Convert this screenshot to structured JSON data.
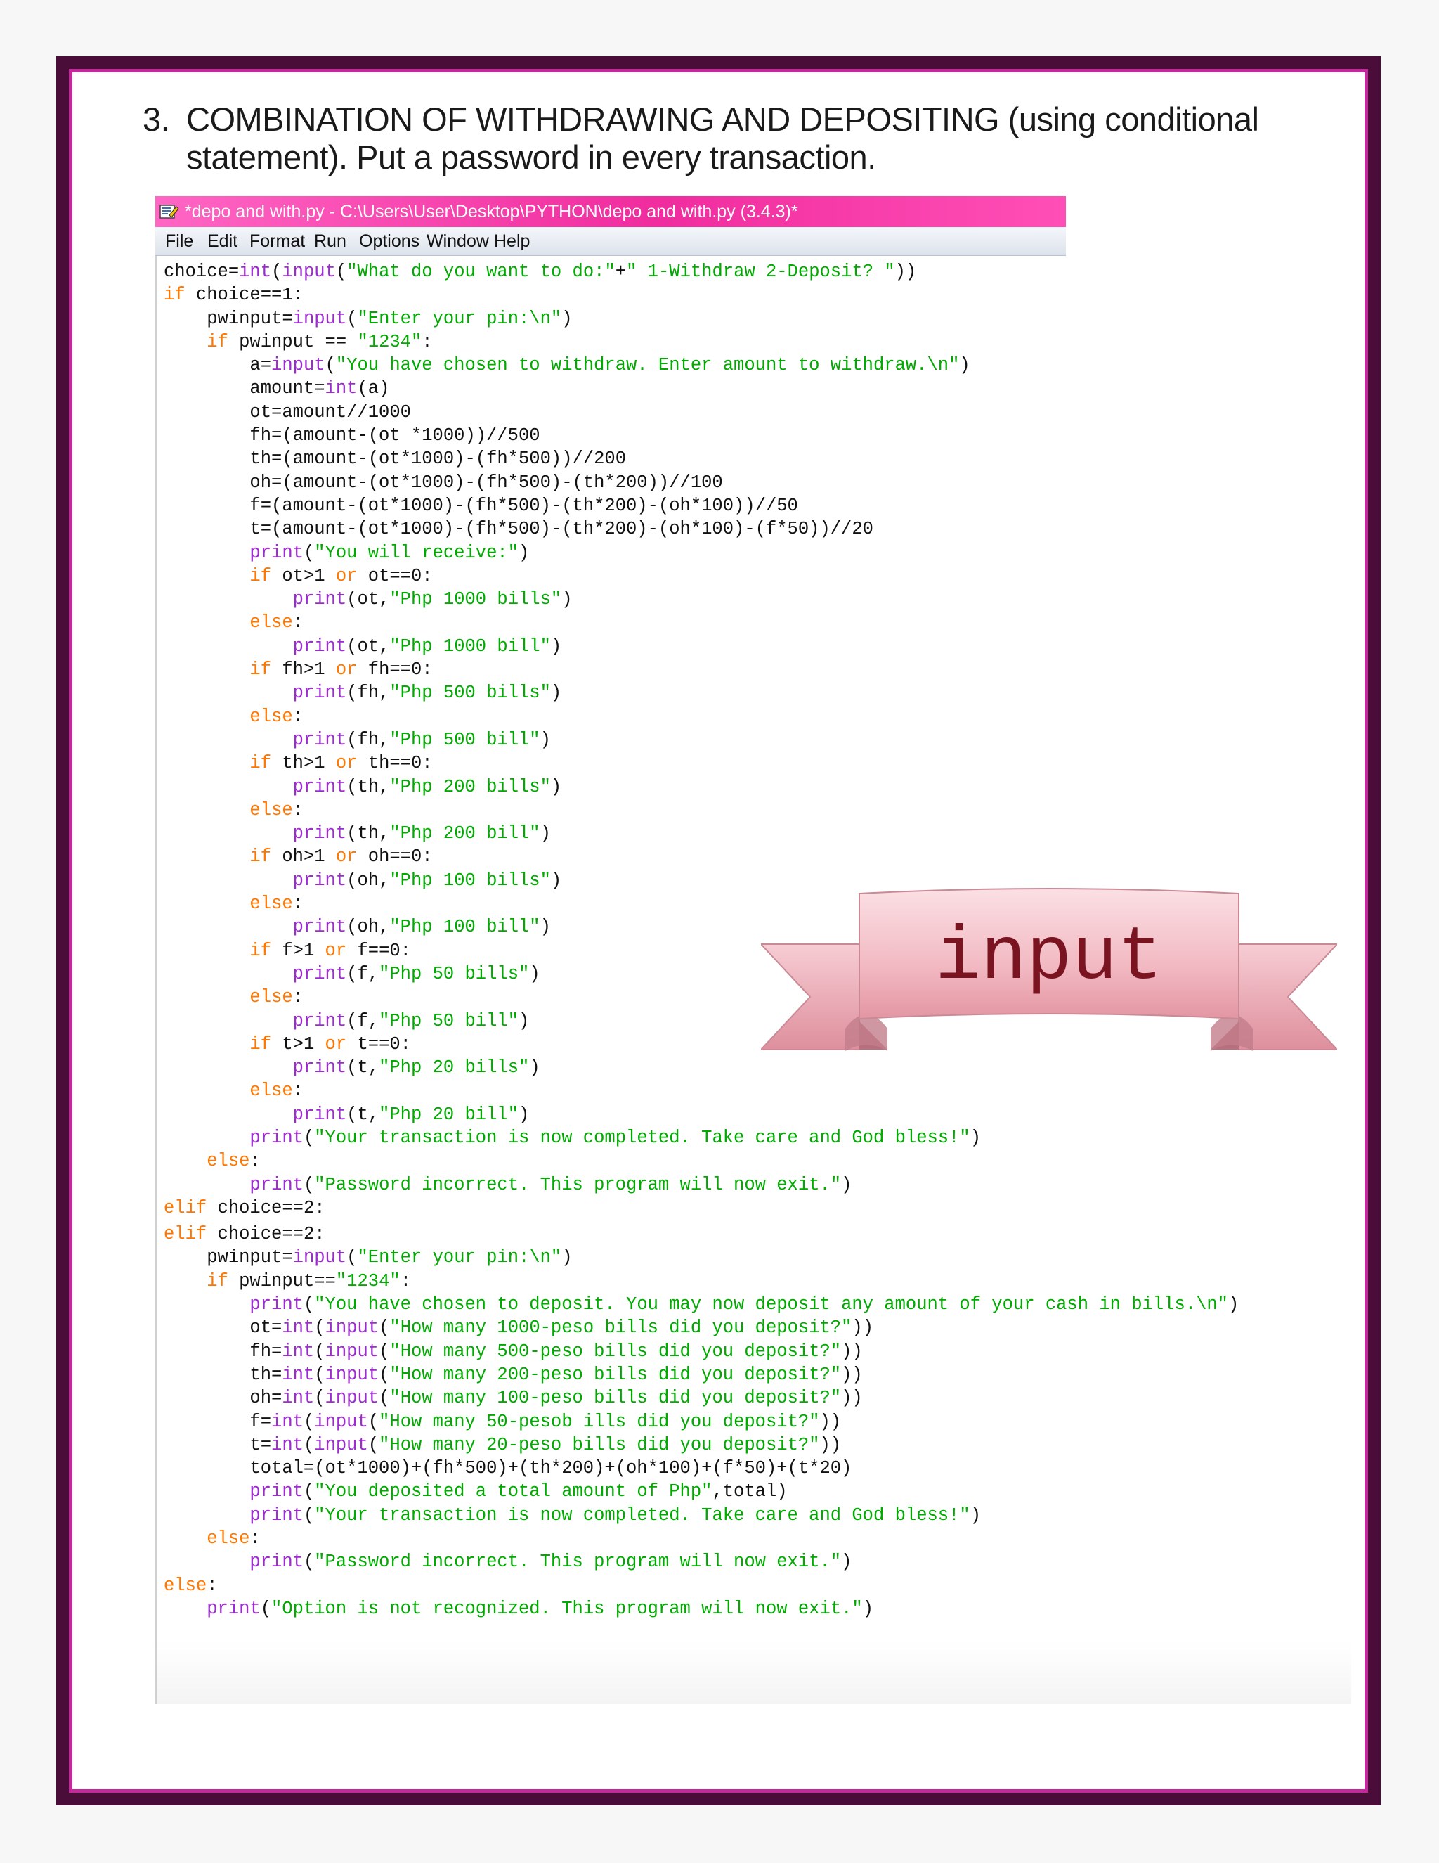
{
  "heading": {
    "number": "3.",
    "line1": "COMBINATION OF WITHDRAWING AND DEPOSITING (using conditional",
    "line2": "statement). Put a password in every transaction."
  },
  "window": {
    "title": "*depo and with.py - C:\\Users\\User\\Desktop\\PYTHON\\depo and with.py (3.4.3)*",
    "icon": "python-idle-icon",
    "menu": [
      "File",
      "Edit",
      "Format",
      "Run",
      "Options",
      "Window",
      "Help"
    ]
  },
  "code_lines": [
    "choice=int(input(\"What do you want to do:\"+\" 1-Withdraw 2-Deposit? \"))",
    "if choice==1:",
    "    pwinput=input(\"Enter your pin:\\n\")",
    "    if pwinput == \"1234\":",
    "        a=input(\"You have chosen to withdraw. Enter amount to withdraw.\\n\")",
    "        amount=int(a)",
    "        ot=amount//1000",
    "        fh=(amount-(ot *1000))//500",
    "        th=(amount-(ot*1000)-(fh*500))//200",
    "        oh=(amount-(ot*1000)-(fh*500)-(th*200))//100",
    "        f=(amount-(ot*1000)-(fh*500)-(th*200)-(oh*100))//50",
    "        t=(amount-(ot*1000)-(fh*500)-(th*200)-(oh*100)-(f*50))//20",
    "        print(\"You will receive:\")",
    "        if ot>1 or ot==0:",
    "            print(ot,\"Php 1000 bills\")",
    "        else:",
    "            print(ot,\"Php 1000 bill\")",
    "        if fh>1 or fh==0:",
    "            print(fh,\"Php 500 bills\")",
    "        else:",
    "            print(fh,\"Php 500 bill\")",
    "        if th>1 or th==0:",
    "            print(th,\"Php 200 bills\")",
    "        else:",
    "            print(th,\"Php 200 bill\")",
    "        if oh>1 or oh==0:",
    "            print(oh,\"Php 100 bills\")",
    "        else:",
    "            print(oh,\"Php 100 bill\")",
    "        if f>1 or f==0:",
    "            print(f,\"Php 50 bills\")",
    "        else:",
    "            print(f,\"Php 50 bill\")",
    "        if t>1 or t==0:",
    "            print(t,\"Php 20 bills\")",
    "        else:",
    "            print(t,\"Php 20 bill\")",
    "        print(\"Your transaction is now completed. Take care and God bless!\")",
    "    else:",
    "        print(\"Password incorrect. This program will now exit.\")",
    "elif choice==2:",
    "elif choice==2:",
    "    pwinput=input(\"Enter your pin:\\n\")",
    "    if pwinput==\"1234\":",
    "        print(\"You have chosen to deposit. You may now deposit any amount of your cash in bills.\\n\")",
    "        ot=int(input(\"How many 1000-peso bills did you deposit?\"))",
    "        fh=int(input(\"How many 500-peso bills did you deposit?\"))",
    "        th=int(input(\"How many 200-peso bills did you deposit?\"))",
    "        oh=int(input(\"How many 100-peso bills did you deposit?\"))",
    "        f=int(input(\"How many 50-pesob ills did you deposit?\"))",
    "        t=int(input(\"How many 20-peso bills did you deposit?\"))",
    "        total=(ot*1000)+(fh*500)+(th*200)+(oh*100)+(f*50)+(t*20)",
    "        print(\"You deposited a total amount of Php\",total)",
    "        print(\"Your transaction is now completed. Take care and God bless!\")",
    "    else:",
    "        print(\"Password incorrect. This program will now exit.\")",
    "else:",
    "    print(\"Option is not recognized. This program will now exit.\")"
  ],
  "ribbon": {
    "label": "input"
  },
  "colors": {
    "frame_dark": "#4a0d3a",
    "frame_pink": "#c22a9b",
    "title_pink": "#f02c9e",
    "keyword": "#ff7700",
    "builtin": "#9d2bd0",
    "string": "#00aa00",
    "ribbon_text": "#7a1420"
  }
}
